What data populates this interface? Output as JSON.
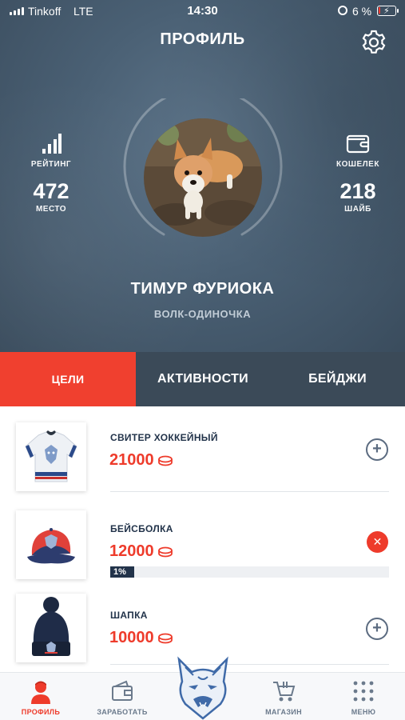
{
  "status_bar": {
    "carrier": "Tinkoff",
    "network": "LTE",
    "time": "14:30",
    "battery_percent": "6 %"
  },
  "header": {
    "title": "ПРОФИЛЬ",
    "settings_icon": "gear-icon"
  },
  "stats": {
    "rating": {
      "label": "РЕЙТИНГ",
      "value": "472",
      "unit": "МЕСТО",
      "icon": "bar-chart-icon"
    },
    "wallet": {
      "label": "КОШЕЛЕК",
      "value": "218",
      "unit": "ШАЙБ",
      "icon": "wallet-icon"
    }
  },
  "user": {
    "name": "ТИМУР ФУРИОКА",
    "status": "ВОЛК-ОДИНОЧКА",
    "avatar": "corgi-photo"
  },
  "tabs": [
    {
      "label": "ЦЕЛИ",
      "active": true
    },
    {
      "label": "АКТИВНОСТИ",
      "active": false
    },
    {
      "label": "БЕЙДЖИ",
      "active": false
    }
  ],
  "goals": [
    {
      "name": "СВИТЕР ХОККЕЙНЫЙ",
      "price": "21000",
      "action": "add",
      "image": "hockey-jersey"
    },
    {
      "name": "БЕЙСБОЛКА",
      "price": "12000",
      "action": "remove",
      "progress_label": "1%",
      "progress": 0.01,
      "image": "baseball-cap"
    },
    {
      "name": "ШАПКА",
      "price": "10000",
      "action": "add",
      "image": "beanie"
    }
  ],
  "bottom_nav": [
    {
      "label": "ПРОФИЛЬ",
      "icon": "user-icon",
      "active": true
    },
    {
      "label": "ЗАРАБОТАТЬ",
      "icon": "wallet-icon",
      "active": false
    },
    {
      "label": "",
      "icon": "wolf-logo-icon",
      "active": false
    },
    {
      "label": "МАГАЗИН",
      "icon": "cart-icon",
      "active": false
    },
    {
      "label": "МЕНЮ",
      "icon": "menu-icon",
      "active": false
    }
  ],
  "colors": {
    "accent": "#f0402f",
    "dark": "#22334a",
    "tab_bar": "#3b4a58",
    "header_bg": "#4a6074"
  }
}
